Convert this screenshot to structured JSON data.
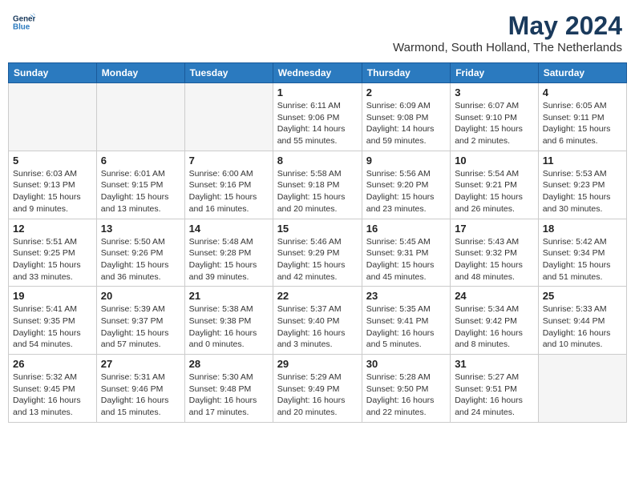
{
  "header": {
    "logo_line1": "General",
    "logo_line2": "Blue",
    "month_year": "May 2024",
    "location": "Warmond, South Holland, The Netherlands"
  },
  "weekdays": [
    "Sunday",
    "Monday",
    "Tuesday",
    "Wednesday",
    "Thursday",
    "Friday",
    "Saturday"
  ],
  "weeks": [
    [
      {
        "day": "",
        "info": ""
      },
      {
        "day": "",
        "info": ""
      },
      {
        "day": "",
        "info": ""
      },
      {
        "day": "1",
        "info": "Sunrise: 6:11 AM\nSunset: 9:06 PM\nDaylight: 14 hours\nand 55 minutes."
      },
      {
        "day": "2",
        "info": "Sunrise: 6:09 AM\nSunset: 9:08 PM\nDaylight: 14 hours\nand 59 minutes."
      },
      {
        "day": "3",
        "info": "Sunrise: 6:07 AM\nSunset: 9:10 PM\nDaylight: 15 hours\nand 2 minutes."
      },
      {
        "day": "4",
        "info": "Sunrise: 6:05 AM\nSunset: 9:11 PM\nDaylight: 15 hours\nand 6 minutes."
      }
    ],
    [
      {
        "day": "5",
        "info": "Sunrise: 6:03 AM\nSunset: 9:13 PM\nDaylight: 15 hours\nand 9 minutes."
      },
      {
        "day": "6",
        "info": "Sunrise: 6:01 AM\nSunset: 9:15 PM\nDaylight: 15 hours\nand 13 minutes."
      },
      {
        "day": "7",
        "info": "Sunrise: 6:00 AM\nSunset: 9:16 PM\nDaylight: 15 hours\nand 16 minutes."
      },
      {
        "day": "8",
        "info": "Sunrise: 5:58 AM\nSunset: 9:18 PM\nDaylight: 15 hours\nand 20 minutes."
      },
      {
        "day": "9",
        "info": "Sunrise: 5:56 AM\nSunset: 9:20 PM\nDaylight: 15 hours\nand 23 minutes."
      },
      {
        "day": "10",
        "info": "Sunrise: 5:54 AM\nSunset: 9:21 PM\nDaylight: 15 hours\nand 26 minutes."
      },
      {
        "day": "11",
        "info": "Sunrise: 5:53 AM\nSunset: 9:23 PM\nDaylight: 15 hours\nand 30 minutes."
      }
    ],
    [
      {
        "day": "12",
        "info": "Sunrise: 5:51 AM\nSunset: 9:25 PM\nDaylight: 15 hours\nand 33 minutes."
      },
      {
        "day": "13",
        "info": "Sunrise: 5:50 AM\nSunset: 9:26 PM\nDaylight: 15 hours\nand 36 minutes."
      },
      {
        "day": "14",
        "info": "Sunrise: 5:48 AM\nSunset: 9:28 PM\nDaylight: 15 hours\nand 39 minutes."
      },
      {
        "day": "15",
        "info": "Sunrise: 5:46 AM\nSunset: 9:29 PM\nDaylight: 15 hours\nand 42 minutes."
      },
      {
        "day": "16",
        "info": "Sunrise: 5:45 AM\nSunset: 9:31 PM\nDaylight: 15 hours\nand 45 minutes."
      },
      {
        "day": "17",
        "info": "Sunrise: 5:43 AM\nSunset: 9:32 PM\nDaylight: 15 hours\nand 48 minutes."
      },
      {
        "day": "18",
        "info": "Sunrise: 5:42 AM\nSunset: 9:34 PM\nDaylight: 15 hours\nand 51 minutes."
      }
    ],
    [
      {
        "day": "19",
        "info": "Sunrise: 5:41 AM\nSunset: 9:35 PM\nDaylight: 15 hours\nand 54 minutes."
      },
      {
        "day": "20",
        "info": "Sunrise: 5:39 AM\nSunset: 9:37 PM\nDaylight: 15 hours\nand 57 minutes."
      },
      {
        "day": "21",
        "info": "Sunrise: 5:38 AM\nSunset: 9:38 PM\nDaylight: 16 hours\nand 0 minutes."
      },
      {
        "day": "22",
        "info": "Sunrise: 5:37 AM\nSunset: 9:40 PM\nDaylight: 16 hours\nand 3 minutes."
      },
      {
        "day": "23",
        "info": "Sunrise: 5:35 AM\nSunset: 9:41 PM\nDaylight: 16 hours\nand 5 minutes."
      },
      {
        "day": "24",
        "info": "Sunrise: 5:34 AM\nSunset: 9:42 PM\nDaylight: 16 hours\nand 8 minutes."
      },
      {
        "day": "25",
        "info": "Sunrise: 5:33 AM\nSunset: 9:44 PM\nDaylight: 16 hours\nand 10 minutes."
      }
    ],
    [
      {
        "day": "26",
        "info": "Sunrise: 5:32 AM\nSunset: 9:45 PM\nDaylight: 16 hours\nand 13 minutes."
      },
      {
        "day": "27",
        "info": "Sunrise: 5:31 AM\nSunset: 9:46 PM\nDaylight: 16 hours\nand 15 minutes."
      },
      {
        "day": "28",
        "info": "Sunrise: 5:30 AM\nSunset: 9:48 PM\nDaylight: 16 hours\nand 17 minutes."
      },
      {
        "day": "29",
        "info": "Sunrise: 5:29 AM\nSunset: 9:49 PM\nDaylight: 16 hours\nand 20 minutes."
      },
      {
        "day": "30",
        "info": "Sunrise: 5:28 AM\nSunset: 9:50 PM\nDaylight: 16 hours\nand 22 minutes."
      },
      {
        "day": "31",
        "info": "Sunrise: 5:27 AM\nSunset: 9:51 PM\nDaylight: 16 hours\nand 24 minutes."
      },
      {
        "day": "",
        "info": ""
      }
    ]
  ]
}
